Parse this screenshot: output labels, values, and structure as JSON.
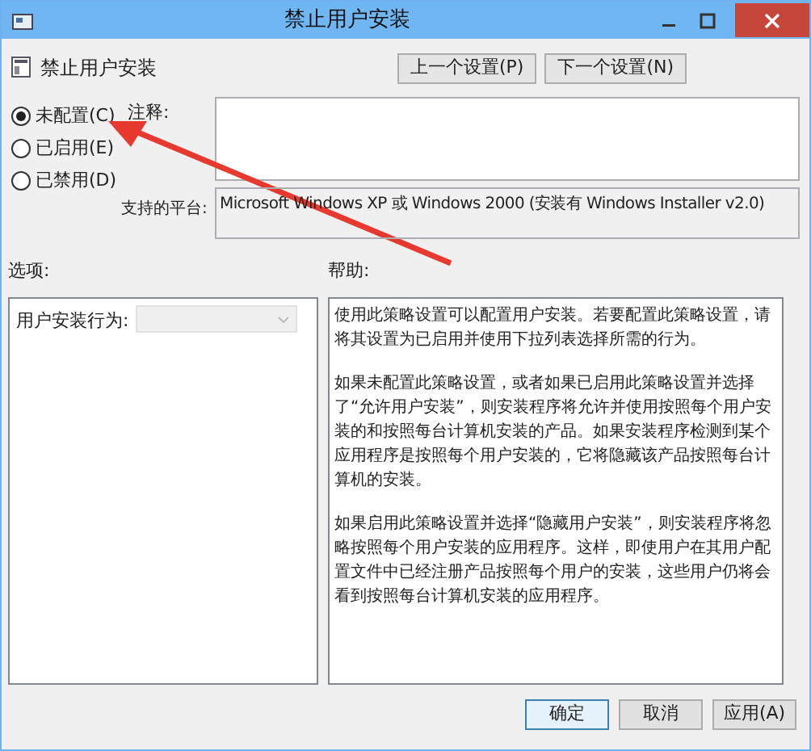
{
  "window": {
    "title": "禁止用户安装"
  },
  "policy": {
    "name": "禁止用户安装"
  },
  "nav_buttons": [
    "上一个设置(P)",
    "下一个设置(N)"
  ],
  "states": [
    {
      "label": "未配置(C)",
      "selected": true
    },
    {
      "label": "已启用(E)",
      "selected": false
    },
    {
      "label": "已禁用(D)",
      "selected": false
    }
  ],
  "comment": {
    "label": "注释:"
  },
  "platform": {
    "label": "支持的平台:",
    "value": "Microsoft Windows XP 或 Windows 2000 (安装有 Windows Installer v2.0)"
  },
  "options": {
    "label": "选项:",
    "field_label": "用户安装行为:",
    "dropdown_disabled": true
  },
  "help": {
    "label": "帮助:",
    "paragraphs": [
      "使用此策略设置可以配置用户安装。若要配置此策略设置，请将其设置为已启用并使用下拉列表选择所需的行为。",
      "如果未配置此策略设置，或者如果已启用此策略设置并选择了“允许用户安装”，则安装程序将允许并使用按照每个用户安装的和按照每台计算机安装的产品。如果安装程序检测到某个应用程序是按照每个用户安装的，它将隐藏该产品按照每台计算机的安装。",
      "如果启用此策略设置并选择“隐藏用户安装”，则安装程序将忽略按照每个用户安装的应用程序。这样，即使用户在其用户配置文件中已经注册产品按照每个用户的安装，这些用户仍将会看到按照每台计算机安装的应用程序。"
    ]
  },
  "buttons": [
    {
      "label": "确定",
      "default": true
    },
    {
      "label": "取消",
      "default": false
    },
    {
      "label": "应用(A)",
      "default": false
    }
  ]
}
